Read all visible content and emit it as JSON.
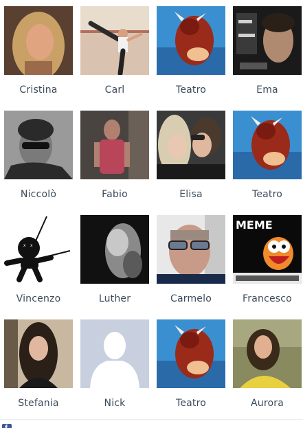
{
  "friends": [
    {
      "name": "Cristina",
      "photo": "portrait-blonde-woman"
    },
    {
      "name": "Carl",
      "photo": "martial-arts-kick"
    },
    {
      "name": "Teatro",
      "photo": "red-minotaur-artwork"
    },
    {
      "name": "Ema",
      "photo": "portrait-man-dark"
    },
    {
      "name": "Niccolò",
      "photo": "portrait-man-sunglasses-bw"
    },
    {
      "name": "Fabio",
      "photo": "portrait-man-red-shirt"
    },
    {
      "name": "Elisa",
      "photo": "two-women-selfie"
    },
    {
      "name": "Teatro",
      "photo": "red-minotaur-artwork"
    },
    {
      "name": "Vincenzo",
      "photo": "voodoo-doll-icon"
    },
    {
      "name": "Luther",
      "photo": "blurry-bw-figure"
    },
    {
      "name": "Carmelo",
      "photo": "portrait-man-glasses"
    },
    {
      "name": "Francesco",
      "photo": "meme-muppet"
    },
    {
      "name": "Stefania",
      "photo": "portrait-woman-long-hair"
    },
    {
      "name": "Nick",
      "photo": "default-profile-silhouette"
    },
    {
      "name": "Teatro",
      "photo": "red-minotaur-artwork"
    },
    {
      "name": "Aurora",
      "photo": "portrait-woman-yellow"
    }
  ],
  "meme_text": "MEME",
  "colors": {
    "name_text": "#3b4a5a",
    "facebook_blue": "#3b5998",
    "default_avatar_bg": "#c8d0e0"
  }
}
